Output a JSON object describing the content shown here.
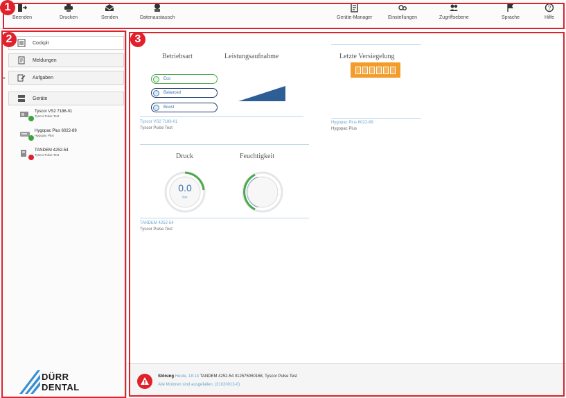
{
  "callouts": [
    "1",
    "2",
    "3"
  ],
  "toolbar": {
    "left": [
      {
        "label": "Beenden",
        "icon": "exit-icon"
      },
      {
        "label": "Drucken",
        "icon": "printer-icon"
      },
      {
        "label": "Senden",
        "icon": "envelope-icon"
      },
      {
        "label": "Datenaustausch",
        "icon": "data-exchange-icon"
      }
    ],
    "right": [
      {
        "label": "Geräte-Manager",
        "icon": "device-manager-icon"
      },
      {
        "label": "Einstellungen",
        "icon": "settings-icon"
      },
      {
        "label": "Zugriffsebene",
        "icon": "users-icon"
      },
      {
        "label": "Sprache",
        "icon": "flag-icon"
      },
      {
        "label": "Hilfe",
        "icon": "help-icon"
      }
    ]
  },
  "sidebar": {
    "nav": [
      {
        "label": "Cockpit",
        "icon": "cockpit-icon",
        "active": true
      },
      {
        "label": "Meldungen",
        "icon": "messages-icon",
        "active": false
      },
      {
        "label": "Aufgaben",
        "icon": "tasks-icon",
        "active": false
      },
      {
        "label": "Geräte",
        "icon": "devices-icon",
        "active": false
      }
    ],
    "devices": [
      {
        "name": "Tyscor VS2 7186-01",
        "sub": "Tyscor Pulse Test",
        "status": "ok"
      },
      {
        "name": "Hygopac Plus 6022-89",
        "sub": "Hygopac Plus",
        "status": "ok"
      },
      {
        "name": "TANDEM 4252-54",
        "sub": "Tyscor Pulse Test",
        "status": "error"
      }
    ],
    "logo": {
      "line1": "DÜRR",
      "line2": "DENTAL"
    }
  },
  "main": {
    "card1": {
      "head1": "Betriebsart",
      "head2": "Leistungsaufnahme",
      "modes": [
        "Eco",
        "Balanced",
        "Boost"
      ],
      "active_mode": 0,
      "device": "Tyscor VS2 7186-01",
      "sub": "Tyscor Pulse Test"
    },
    "card2": {
      "head": "Letzte Versiegelung",
      "device": "Hygopac Plus 6022-89",
      "sub": "Hygopac Plus"
    },
    "card3": {
      "head1": "Druck",
      "head2": "Feuchtigkeit",
      "pressure_value": "0.0",
      "pressure_unit": "bar",
      "device": "TANDEM 4252-54",
      "sub": "Tyscor Pulse Test"
    }
  },
  "statusbar": {
    "type": "Störung",
    "time": "Heute, 18:14",
    "text": "TANDEM 4252-54 012575050168, Tyscor Pulse Test",
    "detail": "Alle Motoren sind ausgefallen. (31020013-0)"
  },
  "colors": {
    "accent_red": "#e0212b",
    "link_blue": "#6aa6cf",
    "ok_green": "#3aa53a",
    "seal_orange": "#f39c29"
  }
}
